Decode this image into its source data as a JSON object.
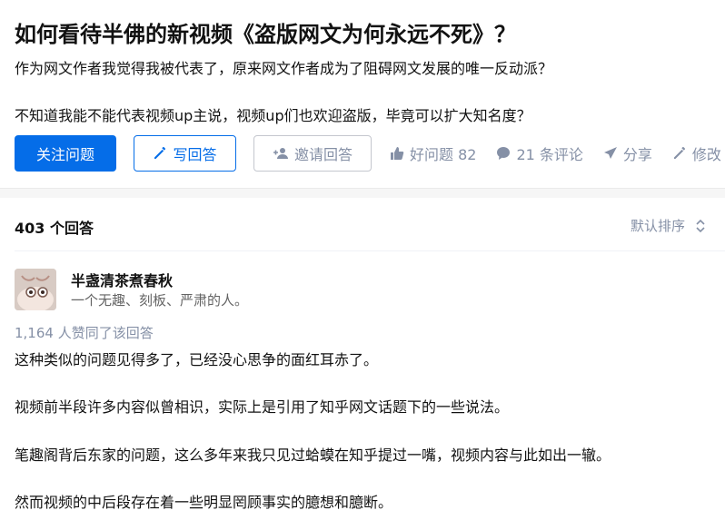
{
  "question": {
    "title": "如何看待半佛的新视频《盗版网文为何永远不死》？",
    "detail_line1": "作为网文作者我觉得我被代表了，原来网文作者成为了阻碍网文发展的唯一反动派？",
    "detail_line2": "不知道我能不能代表视频up主说，视频up们也欢迎盗版，毕竟可以扩大知名度？"
  },
  "actions": {
    "follow": "关注问题",
    "write": "写回答",
    "invite": "邀请回答",
    "good_question": "好问题 82",
    "comments": "21 条评论",
    "share": "分享",
    "edit": "修改"
  },
  "answers": {
    "count_label": "403 个回答",
    "sort_label": "默认排序"
  },
  "answer": {
    "author_name": "半盏清茶煮春秋",
    "author_bio": "一个无趣、刻板、严肃的人。",
    "votes_label": "1,164 人赞同了该回答",
    "paragraphs": [
      "这种类似的问题见得多了，已经没心思争的面红耳赤了。",
      "视频前半段许多内容似曾相识，实际上是引用了知乎网文话题下的一些说法。",
      "笔趣阁背后东家的问题，这么多年来我只见过蛤蟆在知乎提过一嘴，视频内容与此如出一辙。",
      "然而视频的中后段存在着一些明显罔顾事实的臆想和臆断。"
    ]
  },
  "colors": {
    "primary": "#056de8",
    "muted": "#8590a6",
    "text": "#121212"
  }
}
